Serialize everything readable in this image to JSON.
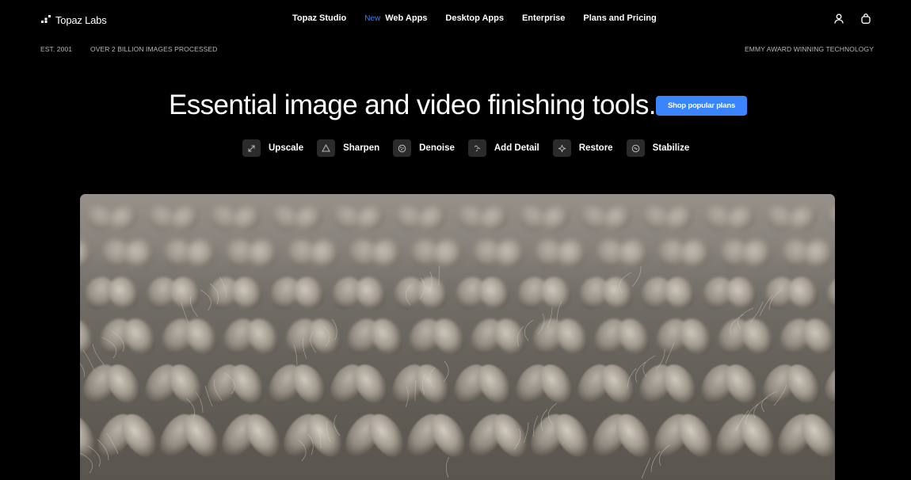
{
  "header": {
    "logo_text": "Topaz Labs",
    "logo_icon": "topaz-dots-logo",
    "nav": [
      {
        "label": "Topaz Studio",
        "badge": ""
      },
      {
        "label": "Web Apps",
        "badge": "New"
      },
      {
        "label": "Desktop Apps",
        "badge": ""
      },
      {
        "label": "Enterprise",
        "badge": ""
      },
      {
        "label": "Plans and Pricing",
        "badge": ""
      }
    ],
    "icons": [
      "user-icon",
      "shopping-bag-icon"
    ],
    "badge_color": "#3d7cf5"
  },
  "subbar": {
    "est": "EST. 2001",
    "processed": "OVER 2 BILLION IMAGES PROCESSED",
    "award": "EMMY AWARD WINNING TECHNOLOGY"
  },
  "hero": {
    "title": "Essential image and video finishing tools.",
    "cta_label": "Shop popular plans",
    "cta_color": "#3a85ff"
  },
  "tools": [
    {
      "label": "Upscale",
      "icon": "upscale-arrows-icon"
    },
    {
      "label": "Sharpen",
      "icon": "sharpen-triangle-icon"
    },
    {
      "label": "Denoise",
      "icon": "denoise-circle-icon"
    },
    {
      "label": "Add Detail",
      "icon": "add-detail-icon"
    },
    {
      "label": "Restore",
      "icon": "restore-sparkle-icon"
    },
    {
      "label": "Stabilize",
      "icon": "stabilize-icon"
    }
  ],
  "media": {
    "subject": "knit-wool-closeup"
  }
}
